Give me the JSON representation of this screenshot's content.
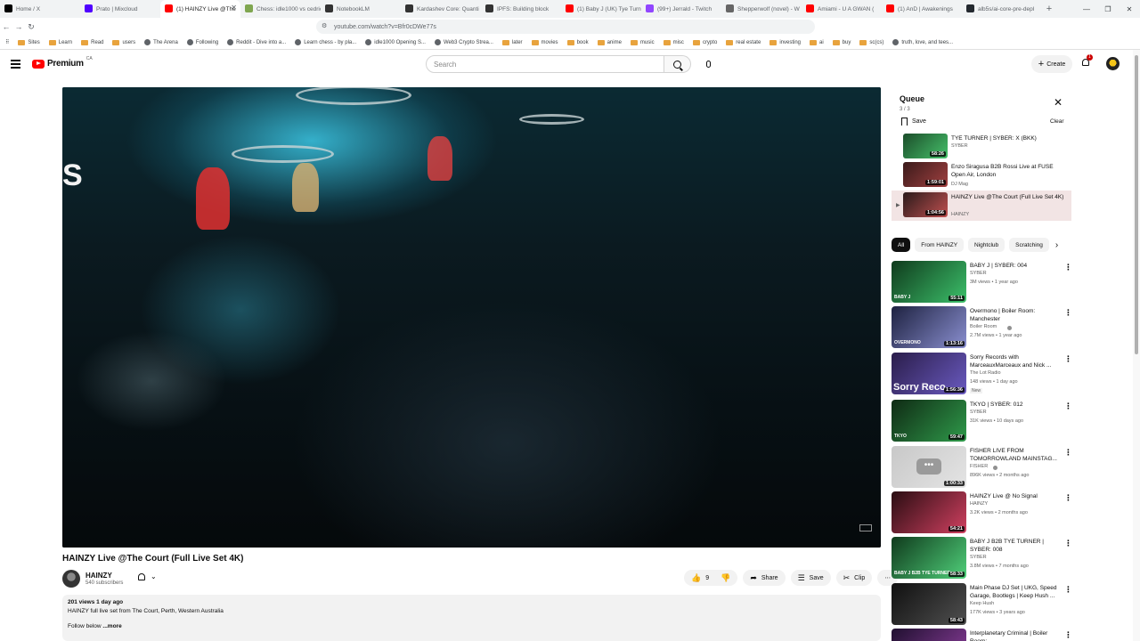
{
  "browser": {
    "tabs": [
      {
        "title": "Home / X",
        "color": "#000000"
      },
      {
        "title": "Prato | Mixcloud",
        "color": "#5000ff"
      },
      {
        "title": "(1) HAINZY Live @The",
        "color": "#ff0000",
        "active": true
      },
      {
        "title": "Chess: idle1000 vs cedric",
        "color": "#7fa650"
      },
      {
        "title": "NotebookLM",
        "color": "#333333"
      },
      {
        "title": "Kardashev Core: Quanti",
        "color": "#333333"
      },
      {
        "title": "IPFS: Building block",
        "color": "#333333"
      },
      {
        "title": "(1) Baby J (UK) Tye Turne",
        "color": "#ff0000"
      },
      {
        "title": "(99+) Jerrald - Twitch",
        "color": "#9146ff"
      },
      {
        "title": "Shepperwolf (novel) - W",
        "color": "#666666"
      },
      {
        "title": "Amiami - U A GWAN (",
        "color": "#ff0000"
      },
      {
        "title": "(1) AnD | Awakenings",
        "color": "#ff0000"
      },
      {
        "title": "alb5s/ai-core-pre-depl",
        "color": "#24292f"
      }
    ],
    "url": "youtube.com/watch?v=Bfr0cDWe77s",
    "bookmarks": [
      "Sites",
      "Learn",
      "Read",
      "users",
      "The Arena",
      "Following",
      "Reddit - Dive into a...",
      "Learn chess - by pla...",
      "idle1000 Opening S...",
      "Web3 Crypto Strea...",
      "later",
      "movies",
      "book",
      "anime",
      "music",
      "misc",
      "crypto",
      "real estate",
      "investing",
      "ai",
      "buy",
      "sc(cs)",
      "truth, love, and tees..."
    ]
  },
  "header": {
    "brand": "Premium",
    "country_code": "CA",
    "search_placeholder": "Search",
    "create_label": "Create",
    "notification_count": "1"
  },
  "video": {
    "title": "HAINZY Live @The Court (Full Live Set 4K)",
    "overlay_letter": "S",
    "channel": "HAINZY",
    "subscribers": "540 subscribers",
    "likes": "9",
    "share_label": "Share",
    "save_label": "Save",
    "clip_label": "Clip",
    "views_date": "201 views  1 day ago",
    "description": "HAINZY full live set from The Court, Perth, Western Australia",
    "follow": "Follow below",
    "more": "...more"
  },
  "queue": {
    "title": "Queue",
    "count": "3 / 3",
    "save_label": "Save",
    "clear_label": "Clear",
    "items": [
      {
        "title": "TYE TURNER | SYBER: X (BKK)",
        "channel": "SYBER",
        "duration": "58:26",
        "thumb": [
          "#1b4d2a",
          "#46c06a"
        ]
      },
      {
        "title": "Enzo Siragusa B2B Rossi Live at FUSE Open Air, London",
        "channel": "DJ Mag",
        "duration": "1:59:01",
        "thumb": [
          "#3a1a1a",
          "#a04040"
        ]
      },
      {
        "title": "HAINZY Live @The Court (Full Live Set 4K)",
        "channel": "HAINZY",
        "duration": "1:04:56",
        "thumb": [
          "#2a1a1a",
          "#c05050"
        ],
        "active": true
      }
    ]
  },
  "chips": [
    "All",
    "From HAINZY",
    "Nightclub",
    "Scratching"
  ],
  "recommendations": [
    {
      "title": "BABY J | SYBER: 004",
      "channel": "SYBER",
      "meta": "3M views • 1 year ago",
      "duration": "55:11",
      "caption": "BABY J",
      "thumb": [
        "#0f3a1c",
        "#3cc06a"
      ]
    },
    {
      "title": "Overmono | Boiler Room: Manchester",
      "channel": "Boiler Room",
      "verified": true,
      "meta": "2.7M views • 1 year ago",
      "duration": "1:13:16",
      "caption": "OVERMONO",
      "thumb": [
        "#1d2140",
        "#8a8fd0"
      ]
    },
    {
      "title": "Sorry Records with MarceauxMarceaux and Nick ...",
      "channel": "The Lot Radio",
      "meta": "148 views • 1 day ago",
      "badge": "New",
      "duration": "1:56:36",
      "caption_big": "Sorry Reco",
      "thumb": [
        "#2a1d4a",
        "#6a5ac0"
      ]
    },
    {
      "title": "TKYO | SYBER: 012",
      "channel": "SYBER",
      "meta": "31K views • 10 days ago",
      "duration": "59:47",
      "caption": "TKYO",
      "thumb": [
        "#0f2a14",
        "#2f9a4a"
      ]
    },
    {
      "title": "FISHER LIVE FROM TOMORROWLAND MAINSTAG...",
      "channel": "FISHER",
      "verified": true,
      "meta": "896K views • 2 months ago",
      "duration": "1:00:33",
      "thumb": [
        "#c8c8c8",
        "#e4e4e4"
      ],
      "placeholder": true
    },
    {
      "title": "HAINZY Live @ No Signal",
      "channel": "HAINZY",
      "meta": "3.2K views • 2 months ago",
      "duration": "54:21",
      "thumb": [
        "#2a0d12",
        "#d04060"
      ]
    },
    {
      "title": "BABY J B2B TYE TURNER | SYBER: 008",
      "channel": "SYBER",
      "meta": "3.8M views • 7 months ago",
      "duration": "58:33",
      "caption": "BABY J B2B TYE TURNER",
      "thumb": [
        "#0f3a1c",
        "#50d07a"
      ]
    },
    {
      "title": "Main Phase DJ Set | UKG, Speed Garage, Bootlegs | Keep Hush ...",
      "channel": "Keep Hush",
      "meta": "177K views • 3 years ago",
      "duration": "58:43",
      "thumb": [
        "#101010",
        "#505050"
      ]
    },
    {
      "title": "Interplanetary Criminal | Boiler Room: ...",
      "channel": "",
      "meta": "",
      "duration": "",
      "thumb": [
        "#201030",
        "#9040a0"
      ]
    }
  ]
}
